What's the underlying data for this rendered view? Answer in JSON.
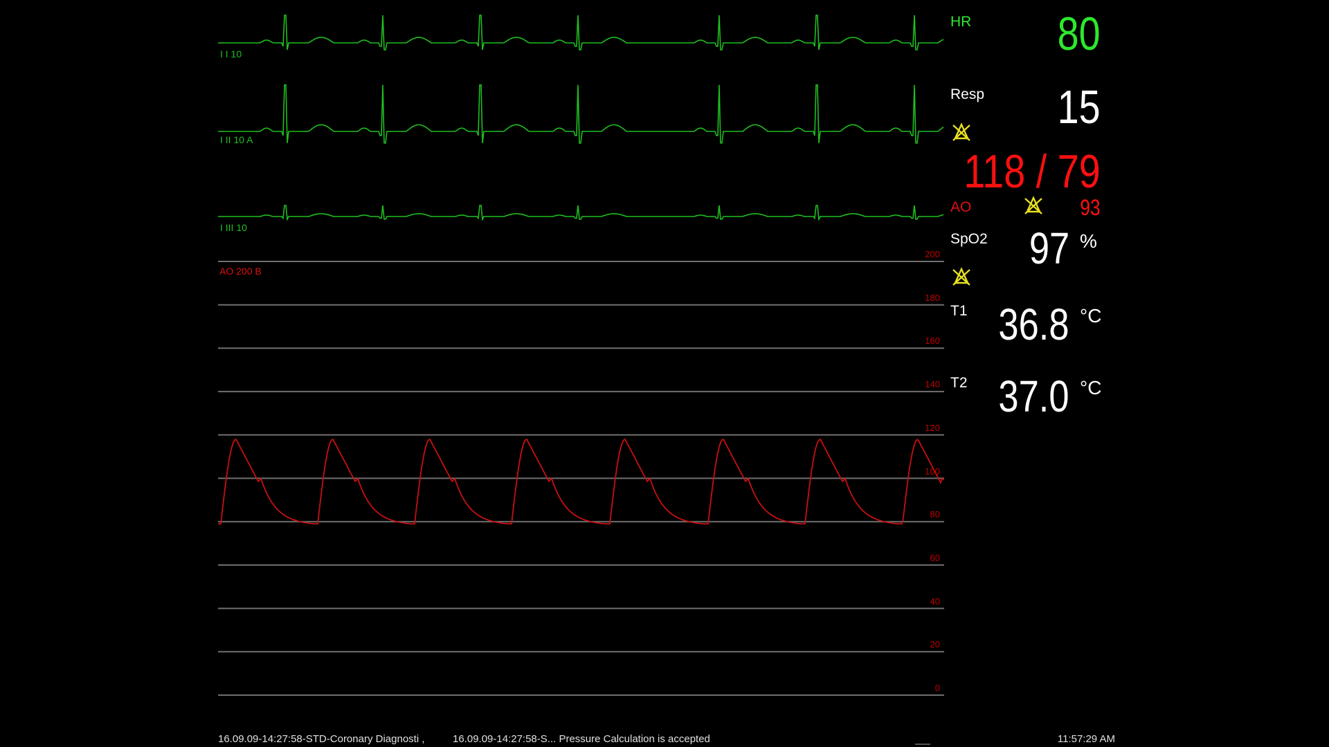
{
  "colors": {
    "ecg": "#1fbf1f",
    "pressure": "#c81010",
    "pressure_label": "#e01010",
    "grid": "#707070",
    "hr_value": "#2de82d",
    "alarm": "#e8e020",
    "text": "#ffffff"
  },
  "traces": {
    "lead1": {
      "label": "I I  10"
    },
    "lead2": {
      "label": "I II  10   A"
    },
    "lead3": {
      "label": "I III  10"
    },
    "ao": {
      "label": "AO   200    B"
    }
  },
  "scale": {
    "ticks": [
      "200",
      "180",
      "160",
      "140",
      "120",
      "100",
      "80",
      "60",
      "40",
      "20",
      "0"
    ]
  },
  "vitals": {
    "hr": {
      "label": "HR",
      "value": "80"
    },
    "resp": {
      "label": "Resp",
      "value": "15",
      "alarm_icon": "alarm-off-icon"
    },
    "ao": {
      "label": "AO",
      "sys_dia": "118 / 79",
      "mean": "93",
      "alarm_icon": "alarm-off-icon"
    },
    "spo2": {
      "label": "SpO2",
      "value": "97",
      "unit": "%",
      "alarm_icon": "alarm-off-icon"
    },
    "t1": {
      "label": "T1",
      "value": "36.8",
      "unit": "°C"
    },
    "t2": {
      "label": "T2",
      "value": "37.0",
      "unit": "°C"
    }
  },
  "status": {
    "message1": "16.09.09-14:27:58-STD-Coronary Diagnosti  ,",
    "message2": "16.09.09-14:27:58-S... Pressure Calculation is accepted",
    "time": "11:57:29 AM"
  }
}
